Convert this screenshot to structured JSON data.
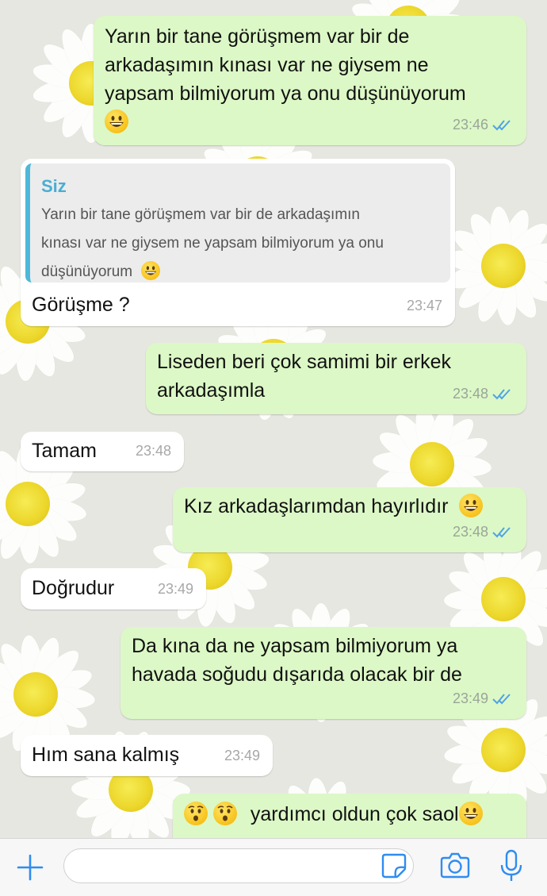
{
  "messages": [
    {
      "id": "m1",
      "dir": "out",
      "text": "Yarın bir tane görüşmem var bir de\narkadaşımın kınası var ne giysem ne\nyapsam bilmiyorum ya onu düşünüyorum",
      "emoji": "grinning-face",
      "time": "23:46",
      "read": true
    },
    {
      "id": "m2",
      "dir": "in",
      "quote_name": "Siz",
      "quote_text": "Yarın bir tane görüşmem var bir de arkadaşımın\nkınası var ne giysem ne yapsam bilmiyorum ya onu\ndüşünüyorum",
      "quote_emoji": "grinning-face",
      "text": "Görüşme ?",
      "time": "23:47"
    },
    {
      "id": "m3",
      "dir": "out",
      "text": "Liseden beri çok samimi bir erkek\narkadaşımla",
      "time": "23:48",
      "read": true
    },
    {
      "id": "m4",
      "dir": "in",
      "text": "Tamam",
      "time": "23:48"
    },
    {
      "id": "m5",
      "dir": "out",
      "text": "Kız arkadaşlarımdan hayırlıdır",
      "emoji": "grinning-face",
      "time": "23:48",
      "read": true
    },
    {
      "id": "m6",
      "dir": "in",
      "text": "Doğrudur",
      "time": "23:49"
    },
    {
      "id": "m7",
      "dir": "out",
      "text": "Da kına da ne yapsam bilmiyorum ya\nhavada soğudu dışarıda olacak bir de",
      "time": "23:49",
      "read": true
    },
    {
      "id": "m8",
      "dir": "in",
      "text": "Hım sana kalmış",
      "time": "23:49"
    },
    {
      "id": "m9",
      "dir": "out",
      "text": "yardımcı oldun çok saol",
      "leading_emojis": [
        "hushed-face",
        "hushed-face"
      ],
      "emoji": "grinning-face",
      "time": "",
      "read": true
    }
  ],
  "input": {
    "placeholder": ""
  },
  "icons": {
    "add": "plus-icon",
    "sticker": "sticker-icon",
    "camera": "camera-icon",
    "mic": "microphone-icon"
  },
  "colors": {
    "outgoing": "#dcf8c6",
    "incoming": "#ffffff",
    "read_ticks": "#4fa3e6",
    "quote_bar": "#4fb8d8",
    "accent": "#2f8cf0"
  }
}
